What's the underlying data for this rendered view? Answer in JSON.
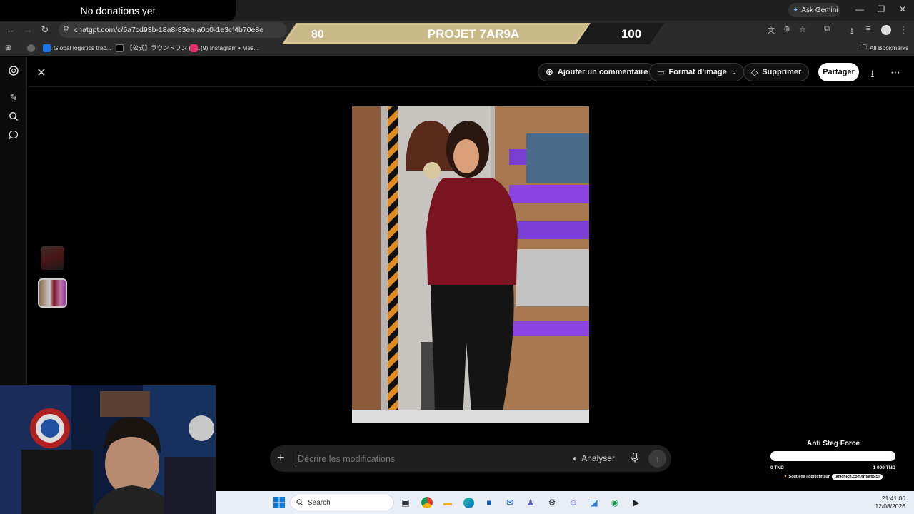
{
  "overlay": {
    "donation_text": "No donations yet",
    "banner": {
      "left_value": "80",
      "title": "PROJET 7AR9A",
      "right_value": "100"
    }
  },
  "browser": {
    "ask_gemini": "Ask Gemini",
    "url": "chatgpt.com/c/6a7cd93b-18a8-83ea-a0b0-1e3cf4b70e8e",
    "bookmarks": [
      {
        "label": "Global logistics trac...",
        "color": "#1a73e8"
      },
      {
        "label": "【公式】ラウンドワン (@...",
        "color": "#000000"
      },
      {
        "label": "(9) Instagram • Mes...",
        "color": "#e1306c"
      }
    ],
    "all_bookmarks": "All Bookmarks"
  },
  "toolbar": {
    "comment_label": "Ajouter un commentaire",
    "format_label": "Format d'image",
    "delete_label": "Supprimer",
    "share_label": "Partager"
  },
  "composer": {
    "placeholder": "Décrire les modifications",
    "analyze_label": "Analyser"
  },
  "widget": {
    "title": "Anti Steg Force",
    "progress": 0,
    "min_label": "0 TND",
    "max_label": "1 000 TND",
    "support_text": "Soutiens l'objectif sur",
    "support_link": "tai9chich.com/fr/MHBISI"
  },
  "taskbar": {
    "search_label": "Search",
    "time": "21:41:06",
    "date": "12/08/2026"
  }
}
